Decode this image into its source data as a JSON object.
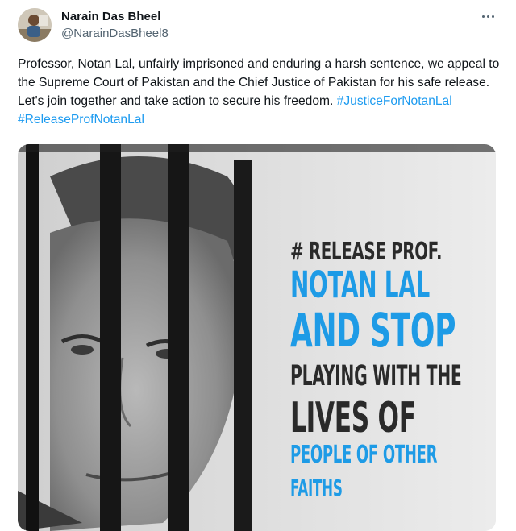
{
  "user": {
    "display_name": "Narain Das Bheel",
    "handle": "@NarainDasBheel8"
  },
  "tweet": {
    "text": "Professor, Notan Lal, unfairly imprisoned and enduring a harsh sentence, we appeal to the Supreme Court of Pakistan and the Chief Justice of Pakistan for his safe release. Let's join together and take action to secure his freedom.",
    "hashtags": [
      "#JusticeForNotanLal",
      "#ReleaseProfNotanLal"
    ]
  },
  "poster": {
    "line1": "# RELEASE PROF.",
    "line2": "NOTAN LAL",
    "line3": "AND STOP",
    "line4": "PLAYING WITH THE",
    "line5": "LIVES OF",
    "line6": "PEOPLE OF OTHER",
    "line7": "FAITHS"
  },
  "icons": {
    "more": "more-dots-icon"
  },
  "colors": {
    "link": "#1d9bf0",
    "poster_blue": "#1e9be6"
  }
}
